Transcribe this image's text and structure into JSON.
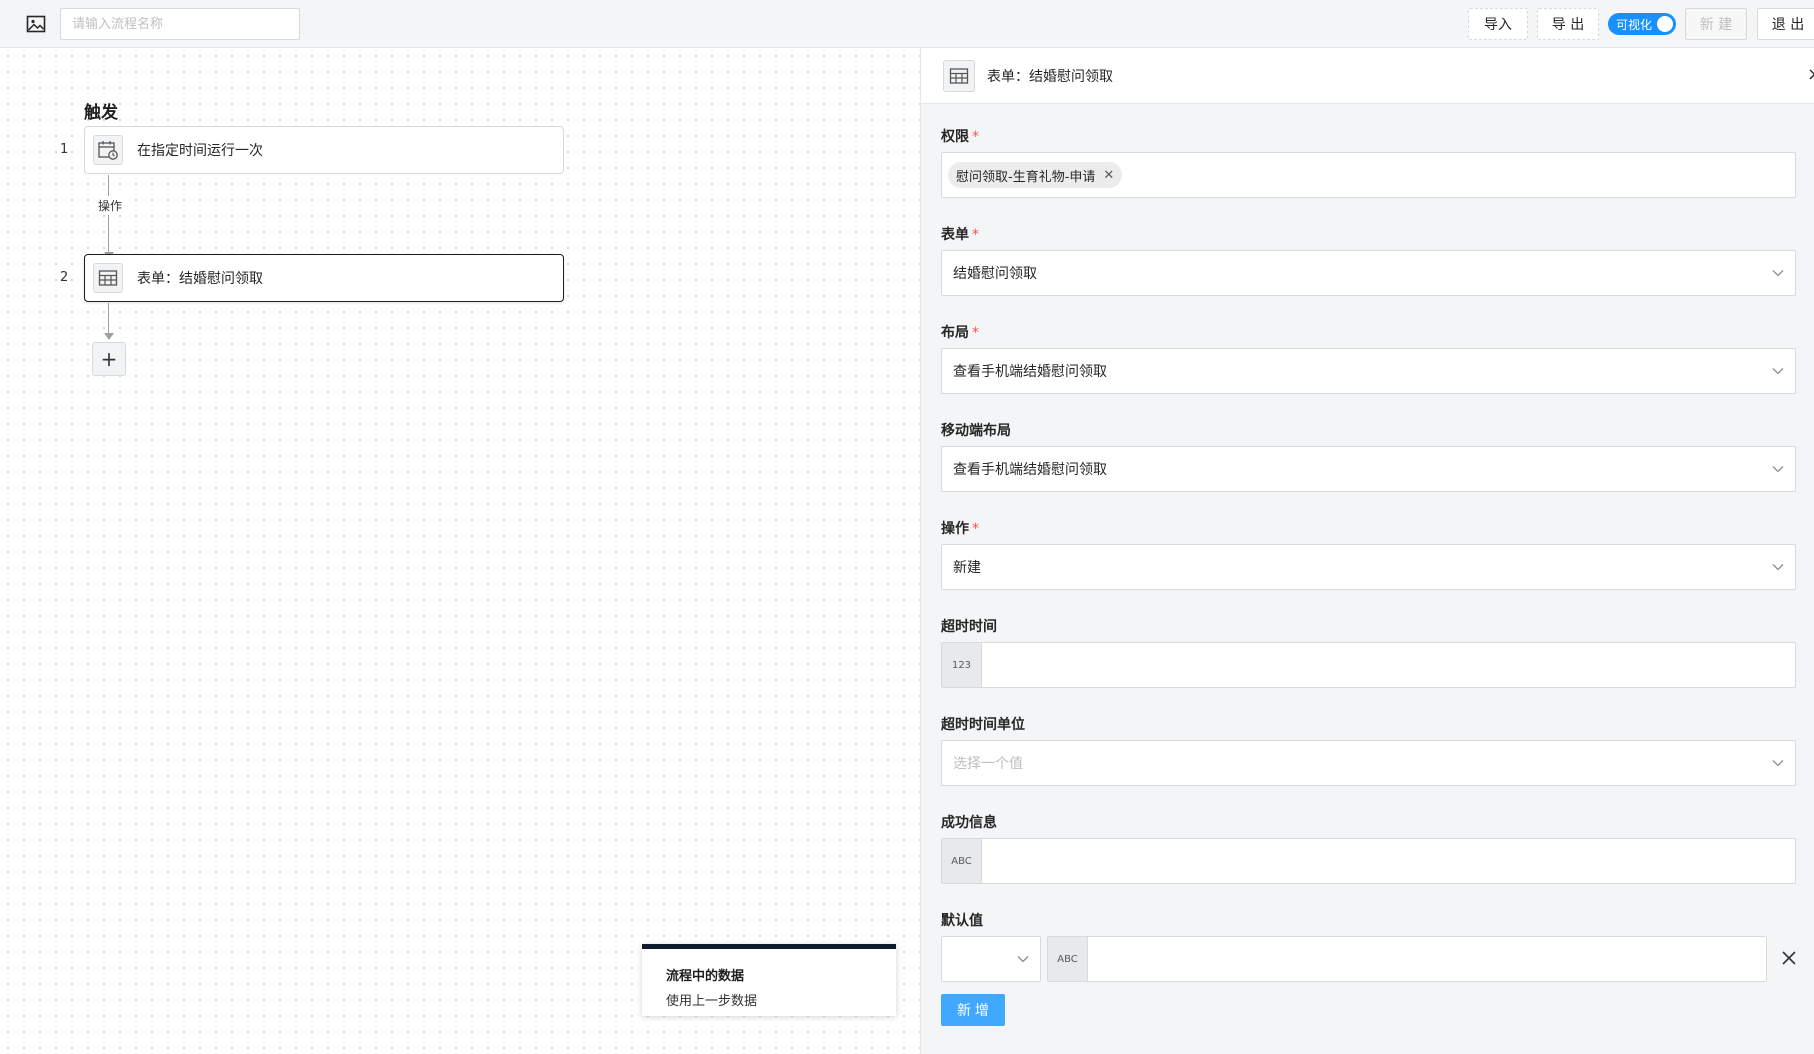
{
  "toolbar": {
    "name_placeholder": "请输入流程名称",
    "import_label": "导入",
    "export_label": "导 出",
    "visual_label": "可视化",
    "new_label": "新 建",
    "exit_label": "退 出"
  },
  "canvas": {
    "trigger_title": "触发",
    "operation_label": "操作",
    "steps": [
      {
        "num": "1",
        "label": "在指定时间运行一次",
        "icon": "calendar-clock-icon"
      },
      {
        "num": "2",
        "label": "表单：结婚慰问领取",
        "icon": "table-icon"
      }
    ],
    "add_label": "+",
    "data_card": {
      "title": "流程中的数据",
      "subtitle": "使用上一步数据"
    }
  },
  "panel": {
    "title": "表单：结婚慰问领取",
    "close_label": "×",
    "fields": {
      "permission": {
        "label": "权限",
        "required": true,
        "tag": "慰问领取-生育礼物-申请"
      },
      "form": {
        "label": "表单",
        "required": true,
        "value": "结婚慰问领取"
      },
      "layout": {
        "label": "布局",
        "required": true,
        "value": "查看手机端结婚慰问领取"
      },
      "mobile_layout": {
        "label": "移动端布局",
        "required": false,
        "value": "查看手机端结婚慰问领取"
      },
      "operation": {
        "label": "操作",
        "required": true,
        "value": "新建"
      },
      "timeout": {
        "label": "超时时间",
        "prefix": "123",
        "value": ""
      },
      "timeout_unit": {
        "label": "超时时间单位",
        "placeholder": "选择一个值"
      },
      "success_msg": {
        "label": "成功信息",
        "prefix": "ABC",
        "value": ""
      },
      "default_value": {
        "label": "默认值",
        "prefix": "ABC",
        "value": ""
      }
    },
    "required_mark": "*",
    "add_button_label": "新 增"
  }
}
